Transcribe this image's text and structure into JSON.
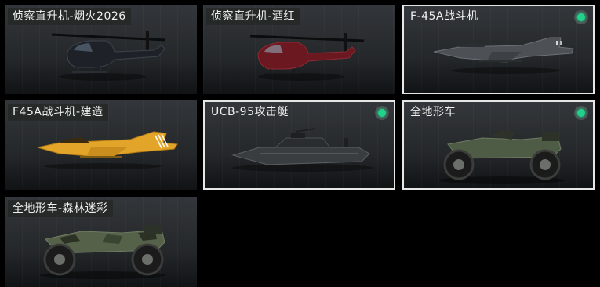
{
  "vehicles": [
    {
      "label": "侦察直升机-烟火2026",
      "selected": false,
      "badge": false,
      "icon": "helicopter-black-icon",
      "color": "#1e2228"
    },
    {
      "label": "侦察直升机-酒红",
      "selected": false,
      "badge": false,
      "icon": "helicopter-red-icon",
      "color": "#6b1820"
    },
    {
      "label": "F-45A战斗机",
      "selected": true,
      "badge": true,
      "icon": "jet-gray-icon",
      "color": "#4d5156"
    },
    {
      "label": "F45A战斗机-建造",
      "selected": false,
      "badge": false,
      "icon": "jet-yellow-icon",
      "color": "#e2a52a"
    },
    {
      "label": "UCB-95攻击艇",
      "selected": true,
      "badge": true,
      "icon": "attack-boat-icon",
      "color": "#3a3d40"
    },
    {
      "label": "全地形车",
      "selected": true,
      "badge": true,
      "icon": "atv-green-icon",
      "color": "#4e5c45"
    },
    {
      "label": "全地形车-森林迷彩",
      "selected": false,
      "badge": false,
      "icon": "atv-camo-icon",
      "color": "#56614a"
    }
  ],
  "colors": {
    "badge_active": "#20d38a",
    "selected_border": "#e6e6e6"
  }
}
